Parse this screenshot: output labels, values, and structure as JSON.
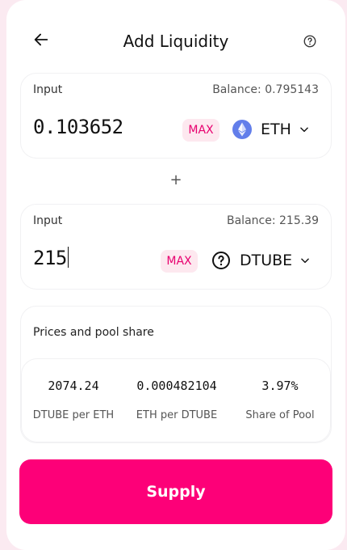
{
  "header": {
    "title": "Add Liquidity",
    "back_icon": "arrow-left-icon",
    "help_icon": "question-circle-icon"
  },
  "input_a": {
    "label": "Input",
    "balance": "Balance: 0.795143",
    "amount": "0.103652",
    "max_label": "MAX",
    "token": {
      "symbol": "ETH",
      "icon": "ethereum-icon"
    }
  },
  "plus": "+",
  "input_b": {
    "label": "Input",
    "balance": "Balance: 215.39",
    "amount": "215",
    "max_label": "MAX",
    "token": {
      "symbol": "DTUBE",
      "icon": "question-circle-icon"
    }
  },
  "prices": {
    "title": "Prices and pool share",
    "items": [
      {
        "value": "2074.24",
        "label": "DTUBE per ETH"
      },
      {
        "value": "0.000482104",
        "label": "ETH per DTUBE"
      },
      {
        "value": "3.97%",
        "label": "Share of Pool"
      }
    ]
  },
  "supply_button": {
    "label": "Supply"
  },
  "colors": {
    "accent": "#fd0078",
    "max_bg": "#fde8ef",
    "max_text": "#e8006f",
    "eth": "#627eea"
  }
}
